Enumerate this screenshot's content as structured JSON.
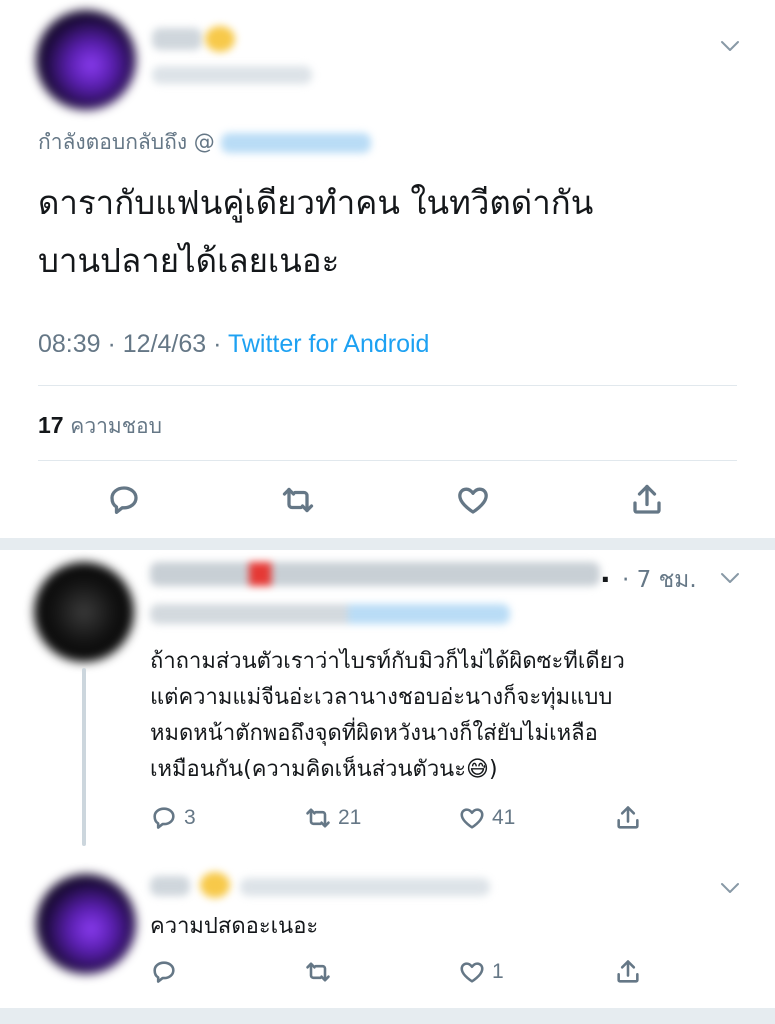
{
  "main_tweet": {
    "replying_to_label": "กำลังตอบกลับถึง @",
    "text_line1": "ดารากับแฟนคู่เดียวทำคน ในทวีตด่ากัน",
    "text_line2": "บานปลายได้เลยเนอะ",
    "time_date": "08:39 · 12/4/63 · ",
    "source": "Twitter for Android",
    "likes_count": "17",
    "likes_label": "ความชอบ",
    "icons": [
      "reply-icon",
      "retweet-icon",
      "like-icon",
      "share-icon"
    ]
  },
  "reply1": {
    "time": "· 7 ชม.",
    "dot": ".",
    "text_lines": [
      "ถ้าถามส่วนตัวเราว่าไบรท์กับมิวก็ไม่ได้ผิดซะทีเดียว",
      "แต่ความแม่จีนอ่ะเวลานางชอบอ่ะนางก็จะทุ่มแบบ",
      "หมดหน้าตักพอถึงจุดที่ผิดหวังนางก็ใส่ยับไม่เหลือ",
      "เหมือนกัน(ความคิดเห็นส่วนตัวนะ😅)"
    ],
    "reply_count": "3",
    "retweet_count": "21",
    "like_count": "41"
  },
  "reply2": {
    "text": "ความปสดอะเนอะ",
    "like_count": "1"
  },
  "colors": {
    "accent": "#1da1f2",
    "muted": "#657786",
    "divider": "#e1e8ed"
  }
}
